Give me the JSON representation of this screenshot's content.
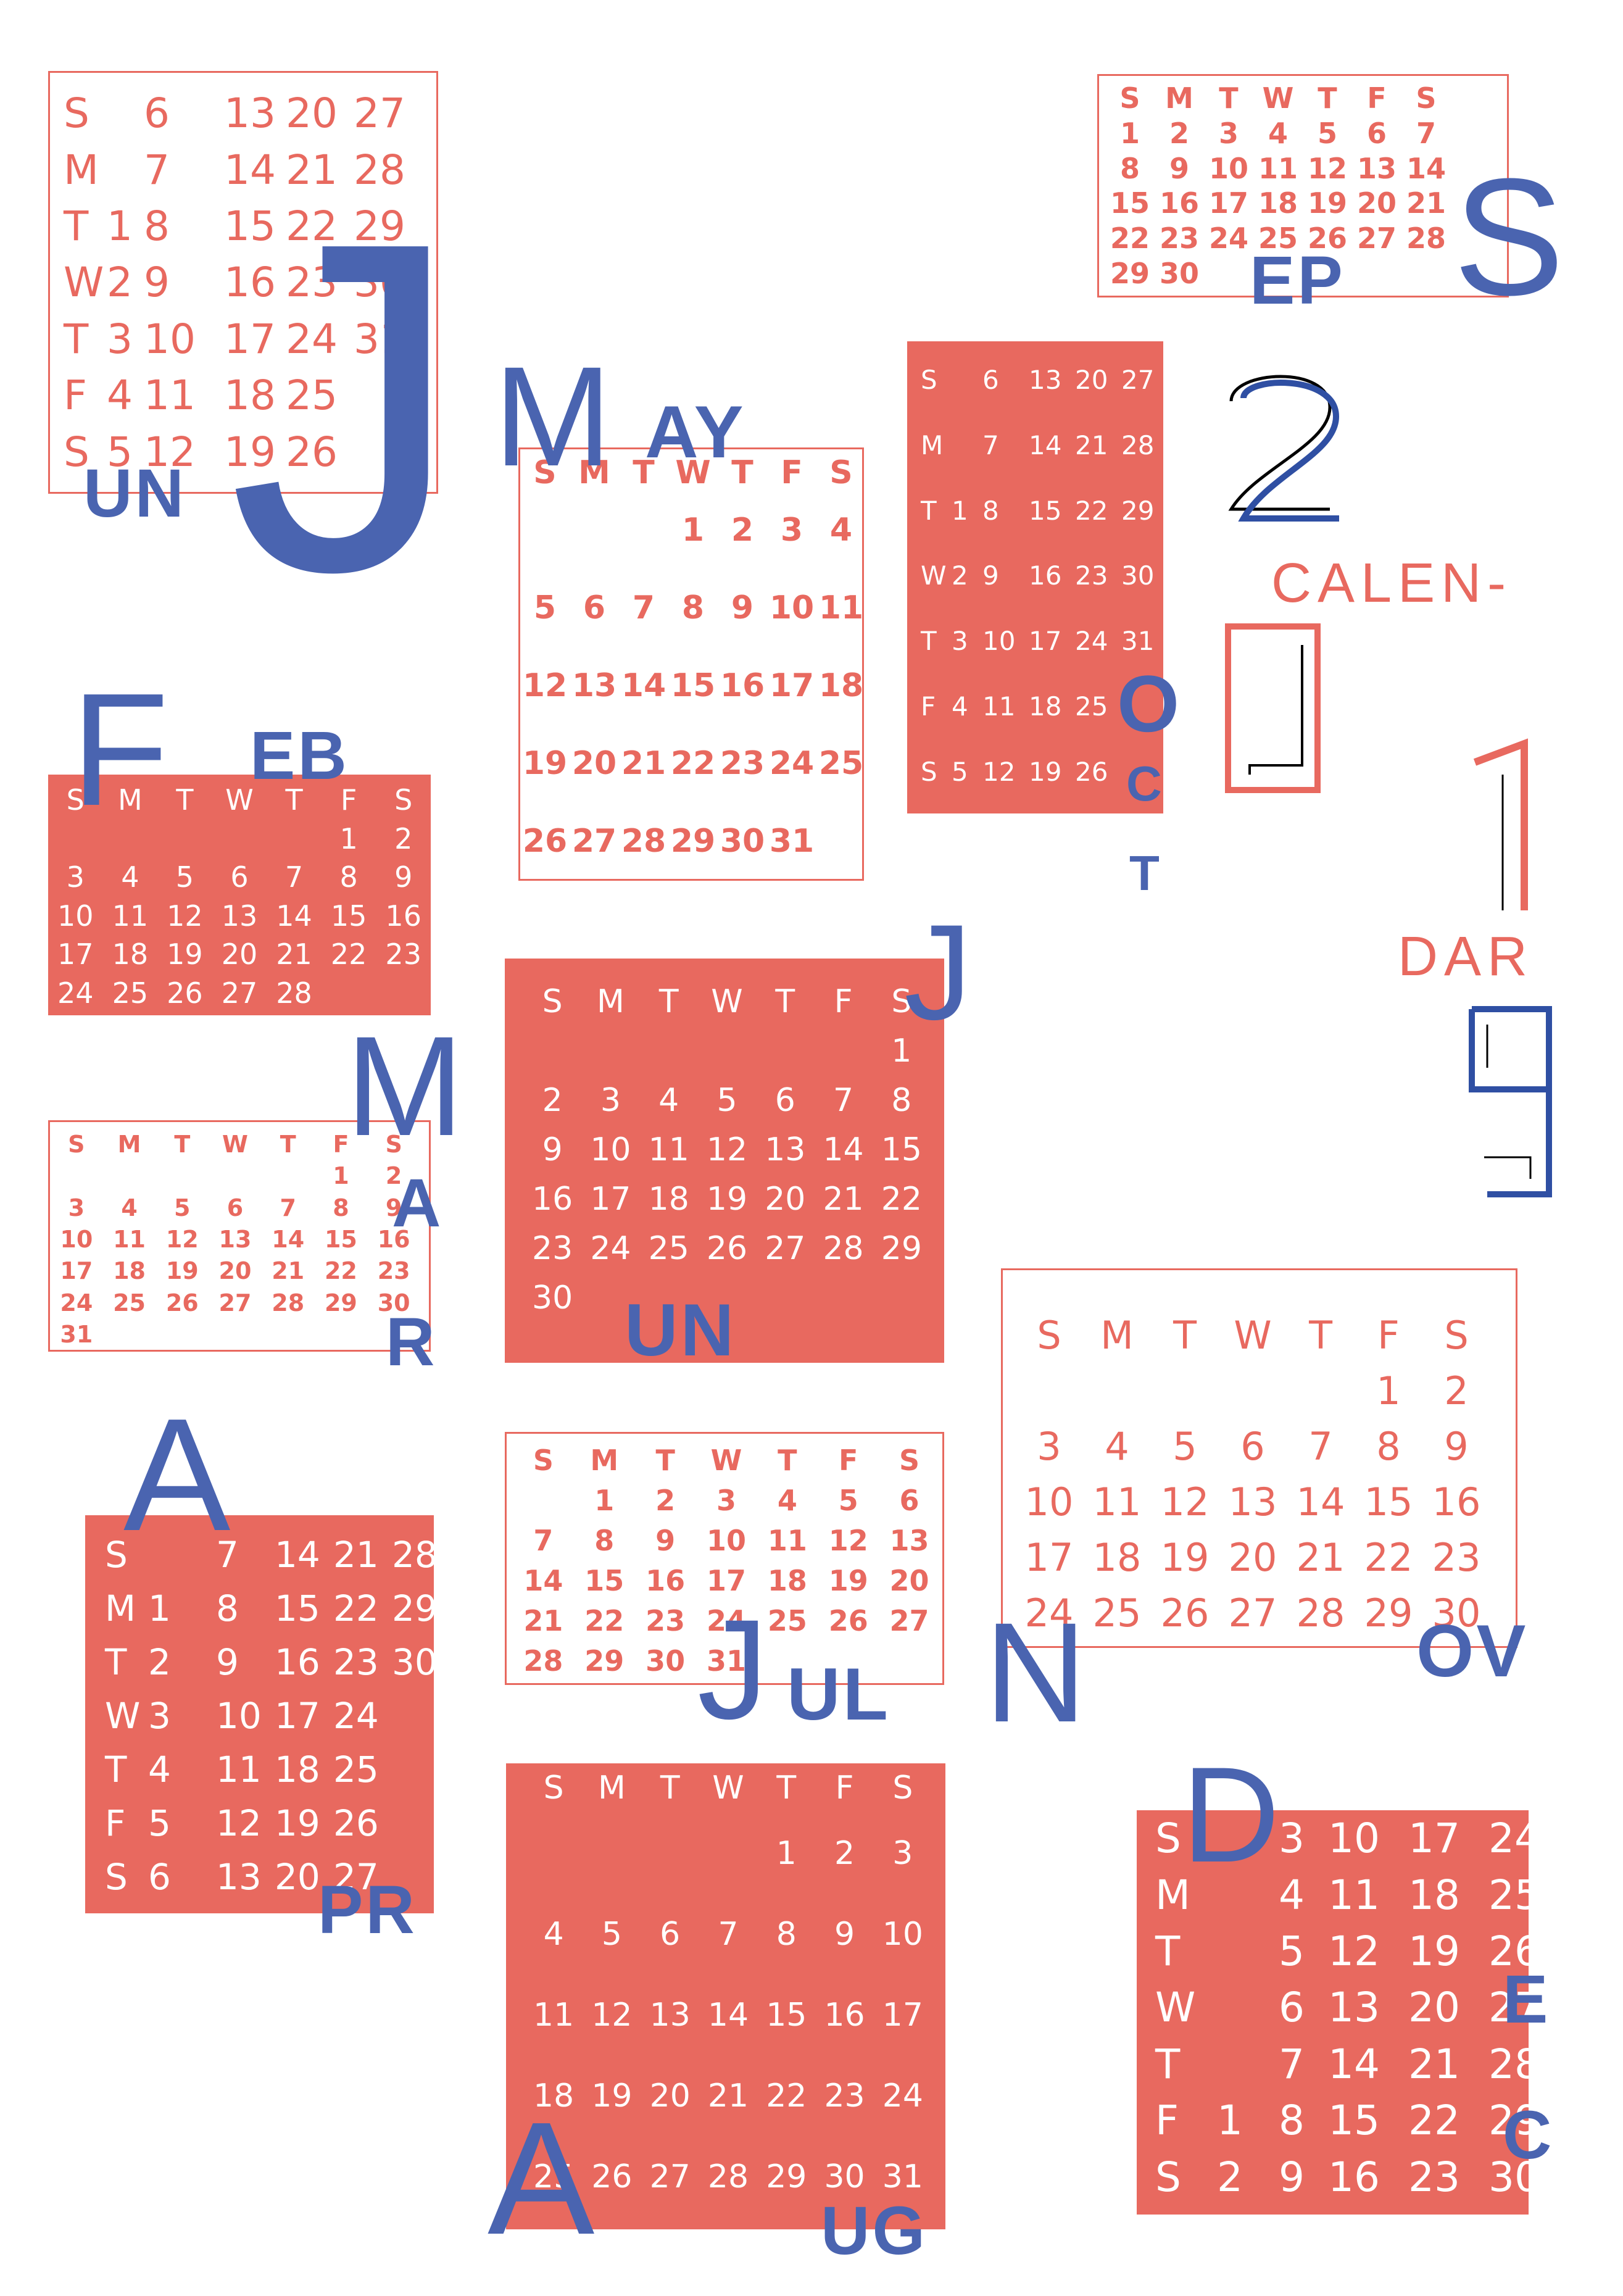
{
  "colors": {
    "red": "#e8695f",
    "blue": "#4a64b0",
    "black": "#000000",
    "white": "#ffffff"
  },
  "title": {
    "line1": "CALEN-",
    "line2": "DAR",
    "year": "2019"
  },
  "months": {
    "jan": {
      "big": "J",
      "rest": "UN"
    },
    "feb": {
      "big": "F",
      "rest": "EB"
    },
    "mar": {
      "big": "M",
      "rest1": "A",
      "rest2": "R"
    },
    "apr": {
      "big": "A",
      "rest": "PR"
    },
    "may": {
      "big": "M",
      "rest": "AY"
    },
    "jun": {
      "big": "J",
      "rest": "UN"
    },
    "jul": {
      "big": "J",
      "rest": "UL"
    },
    "aug": {
      "big": "A",
      "rest": "UG"
    },
    "sep": {
      "big": "S",
      "rest": "EP"
    },
    "oct": {
      "big": "O",
      "rest1": "C",
      "rest2": "T"
    },
    "nov": {
      "big": "N",
      "rest": "OV"
    },
    "dec": {
      "big": "D",
      "rest1": "E",
      "rest2": "C"
    }
  },
  "weekdays": [
    "S",
    "M",
    "T",
    "W",
    "T",
    "F",
    "S"
  ],
  "calendars": {
    "jan": {
      "rows": [
        [
          "S",
          "",
          "6",
          "13",
          "20",
          "27"
        ],
        [
          "M",
          "",
          "7",
          "14",
          "21",
          "28"
        ],
        [
          "T",
          "1",
          "8",
          "15",
          "22",
          "29"
        ],
        [
          "W",
          "2",
          "9",
          "16",
          "23",
          "30"
        ],
        [
          "T",
          "3",
          "10",
          "17",
          "24",
          "31"
        ],
        [
          "F",
          "4",
          "11",
          "18",
          "25",
          ""
        ],
        [
          "S",
          "5",
          "12",
          "19",
          "26",
          ""
        ]
      ]
    },
    "feb": {
      "rows": [
        [
          "",
          "",
          "",
          "",
          "",
          "1",
          "2"
        ],
        [
          "3",
          "4",
          "5",
          "6",
          "7",
          "8",
          "9"
        ],
        [
          "10",
          "11",
          "12",
          "13",
          "14",
          "15",
          "16"
        ],
        [
          "17",
          "18",
          "19",
          "20",
          "21",
          "22",
          "23"
        ],
        [
          "24",
          "25",
          "26",
          "27",
          "28",
          "",
          ""
        ]
      ]
    },
    "mar": {
      "rows": [
        [
          "",
          "",
          "",
          "",
          "",
          "1",
          "2"
        ],
        [
          "3",
          "4",
          "5",
          "6",
          "7",
          "8",
          "9"
        ],
        [
          "10",
          "11",
          "12",
          "13",
          "14",
          "15",
          "16"
        ],
        [
          "17",
          "18",
          "19",
          "20",
          "21",
          "22",
          "23"
        ],
        [
          "24",
          "25",
          "26",
          "27",
          "28",
          "29",
          "30"
        ],
        [
          "31",
          "",
          "",
          "",
          "",
          "",
          ""
        ]
      ]
    },
    "apr": {
      "rows": [
        [
          "S",
          "",
          "7",
          "14",
          "21",
          "28"
        ],
        [
          "M",
          "1",
          "8",
          "15",
          "22",
          "29"
        ],
        [
          "T",
          "2",
          "9",
          "16",
          "23",
          "30"
        ],
        [
          "W",
          "3",
          "10",
          "17",
          "24",
          ""
        ],
        [
          "T",
          "4",
          "11",
          "18",
          "25",
          ""
        ],
        [
          "F",
          "5",
          "12",
          "19",
          "26",
          ""
        ],
        [
          "S",
          "6",
          "13",
          "20",
          "27",
          ""
        ]
      ]
    },
    "may": {
      "rows": [
        [
          "",
          "",
          "",
          "1",
          "2",
          "3",
          "4"
        ],
        [
          "5",
          "6",
          "7",
          "8",
          "9",
          "10",
          "11"
        ],
        [
          "12",
          "13",
          "14",
          "15",
          "16",
          "17",
          "18"
        ],
        [
          "19",
          "20",
          "21",
          "22",
          "23",
          "24",
          "25"
        ],
        [
          "26",
          "27",
          "28",
          "29",
          "30",
          "31",
          ""
        ]
      ]
    },
    "jun": {
      "rows": [
        [
          "",
          "",
          "",
          "",
          "",
          "",
          "1"
        ],
        [
          "2",
          "3",
          "4",
          "5",
          "6",
          "7",
          "8"
        ],
        [
          "9",
          "10",
          "11",
          "12",
          "13",
          "14",
          "15"
        ],
        [
          "16",
          "17",
          "18",
          "19",
          "20",
          "21",
          "22"
        ],
        [
          "23",
          "24",
          "25",
          "26",
          "27",
          "28",
          "29"
        ],
        [
          "30",
          "",
          "",
          "",
          "",
          "",
          ""
        ]
      ]
    },
    "jul": {
      "rows": [
        [
          "",
          "1",
          "2",
          "3",
          "4",
          "5",
          "6"
        ],
        [
          "7",
          "8",
          "9",
          "10",
          "11",
          "12",
          "13"
        ],
        [
          "14",
          "15",
          "16",
          "17",
          "18",
          "19",
          "20"
        ],
        [
          "21",
          "22",
          "23",
          "24",
          "25",
          "26",
          "27"
        ],
        [
          "28",
          "29",
          "30",
          "31",
          "",
          "",
          ""
        ]
      ]
    },
    "aug": {
      "rows": [
        [
          "",
          "",
          "",
          "",
          "1",
          "2",
          "3"
        ],
        [
          "4",
          "5",
          "6",
          "7",
          "8",
          "9",
          "10"
        ],
        [
          "11",
          "12",
          "13",
          "14",
          "15",
          "16",
          "17"
        ],
        [
          "18",
          "19",
          "20",
          "21",
          "22",
          "23",
          "24"
        ],
        [
          "25",
          "26",
          "27",
          "28",
          "29",
          "30",
          "31"
        ]
      ]
    },
    "sep": {
      "rows": [
        [
          "1",
          "2",
          "3",
          "4",
          "5",
          "6",
          "7"
        ],
        [
          "8",
          "9",
          "10",
          "11",
          "12",
          "13",
          "14"
        ],
        [
          "15",
          "16",
          "17",
          "18",
          "19",
          "20",
          "21"
        ],
        [
          "22",
          "23",
          "24",
          "25",
          "26",
          "27",
          "28"
        ],
        [
          "29",
          "30",
          "",
          "",
          "",
          "",
          ""
        ]
      ]
    },
    "oct": {
      "rows": [
        [
          "S",
          "",
          "6",
          "13",
          "20",
          "27"
        ],
        [
          "M",
          "",
          "7",
          "14",
          "21",
          "28"
        ],
        [
          "T",
          "1",
          "8",
          "15",
          "22",
          "29"
        ],
        [
          "W",
          "2",
          "9",
          "16",
          "23",
          "30"
        ],
        [
          "T",
          "3",
          "10",
          "17",
          "24",
          "31"
        ],
        [
          "F",
          "4",
          "11",
          "18",
          "25",
          ""
        ],
        [
          "S",
          "5",
          "12",
          "19",
          "26",
          ""
        ]
      ]
    },
    "nov": {
      "rows": [
        [
          "",
          "",
          "",
          "",
          "",
          "1",
          "2"
        ],
        [
          "3",
          "4",
          "5",
          "6",
          "7",
          "8",
          "9"
        ],
        [
          "10",
          "11",
          "12",
          "13",
          "14",
          "15",
          "16"
        ],
        [
          "17",
          "18",
          "19",
          "20",
          "21",
          "22",
          "23"
        ],
        [
          "24",
          "25",
          "26",
          "27",
          "28",
          "29",
          "30"
        ]
      ]
    },
    "dec": {
      "rows": [
        [
          "S",
          "",
          "3",
          "10",
          "17",
          "24"
        ],
        [
          "M",
          "",
          "4",
          "11",
          "18",
          "25"
        ],
        [
          "T",
          "",
          "5",
          "12",
          "19",
          "26"
        ],
        [
          "W",
          "",
          "6",
          "13",
          "20",
          "27"
        ],
        [
          "T",
          "",
          "7",
          "14",
          "21",
          "28"
        ],
        [
          "F",
          "1",
          "8",
          "15",
          "22",
          "29"
        ],
        [
          "S",
          "2",
          "9",
          "16",
          "23",
          "30"
        ]
      ]
    }
  }
}
